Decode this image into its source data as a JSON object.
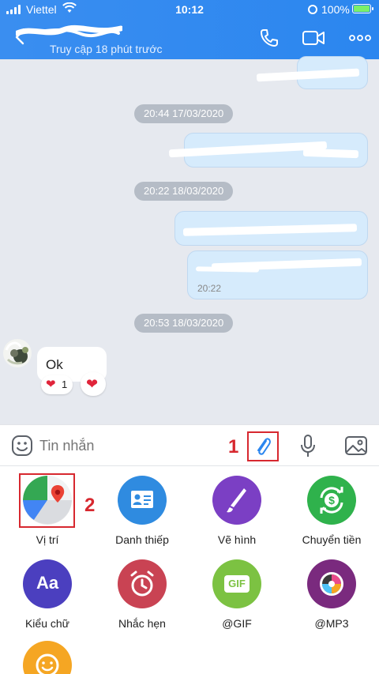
{
  "status_bar": {
    "carrier": "Viettel",
    "time": "10:12",
    "battery_percent": "100%"
  },
  "header": {
    "subtitle": "Truy cập 18 phút trước"
  },
  "messages": [
    {
      "type": "date",
      "label": "20:44 17/03/2020"
    },
    {
      "type": "date",
      "label": "20:22 18/03/2020"
    },
    {
      "type": "time",
      "label": "20:22"
    },
    {
      "type": "date",
      "label": "20:53 18/03/2020"
    },
    {
      "type": "incoming",
      "text": "Ok",
      "reaction_count": "1"
    }
  ],
  "input": {
    "placeholder": "Tin nhắn"
  },
  "annotations": {
    "step1": "1",
    "step2": "2"
  },
  "attachments": [
    {
      "label": "Vị trí",
      "icon": "maps-icon",
      "color": "#4caf50"
    },
    {
      "label": "Danh thiếp",
      "icon": "contact-card-icon",
      "color": "#2f8be0"
    },
    {
      "label": "Vẽ hình",
      "icon": "brush-icon",
      "color": "#7b3fc4"
    },
    {
      "label": "Chuyển tiền",
      "icon": "money-transfer-icon",
      "color": "#2fb24c"
    },
    {
      "label": "Kiểu chữ",
      "icon": "font-style-icon",
      "color": "#4b3fbf",
      "glyph": "Aa"
    },
    {
      "label": "Nhắc hẹn",
      "icon": "alarm-clock-icon",
      "color": "#c94353"
    },
    {
      "label": "@GIF",
      "icon": "gif-icon",
      "color": "#7cc242",
      "glyph": "GIF"
    },
    {
      "label": "@MP3",
      "icon": "music-disc-icon",
      "color": "#7a2a7e"
    },
    {
      "label": "",
      "icon": "smiley-icon",
      "color": "#f5a623"
    }
  ],
  "colors": {
    "header": "#3a8ef0",
    "bubble_out": "#d6ebfc",
    "annotation": "#d7282f"
  }
}
